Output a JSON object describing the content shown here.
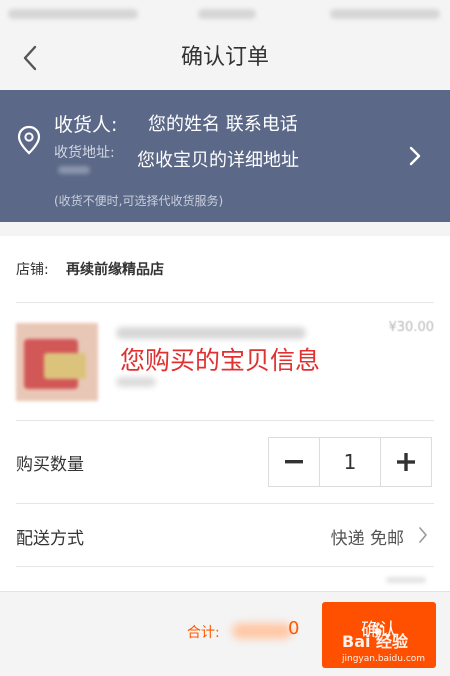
{
  "header": {
    "title": "确认订单",
    "back_icon": "chevron-left-icon"
  },
  "address": {
    "receiver_label": "收货人:",
    "receiver_value": "您的姓名  联系电话",
    "address_label": "收货地址:",
    "address_value": "您收宝贝的详细地址",
    "note": "(收货不便时,可选择代收货服务)",
    "background_color": "#5b6887"
  },
  "shop": {
    "label": "店铺:",
    "name": "再续前缘精品店"
  },
  "product": {
    "price": "¥30.00",
    "info_label": "您购买的宝贝信息"
  },
  "quantity": {
    "label": "购买数量",
    "value": "1",
    "minus_label": "−",
    "plus_label": "+"
  },
  "delivery": {
    "label": "配送方式",
    "value": "快递 免邮"
  },
  "footer": {
    "total_label": "合计:",
    "total_tail": "0",
    "confirm_label": "确认",
    "accent_color": "#ff5000"
  },
  "watermark": {
    "brand": "Bai 经验",
    "url": "jingyan.baidu.com"
  }
}
